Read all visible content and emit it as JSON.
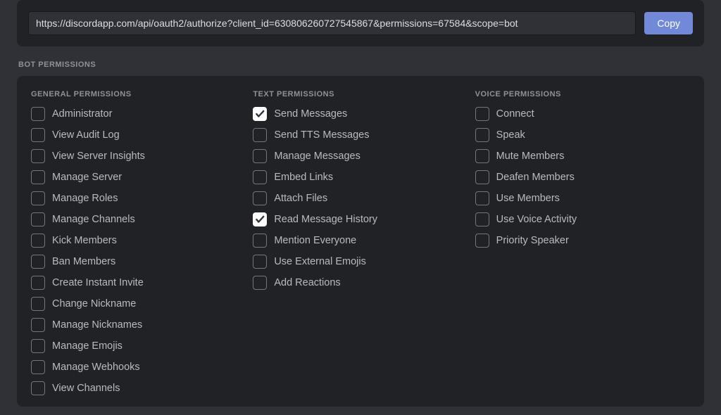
{
  "oauth": {
    "url": "https://discordapp.com/api/oauth2/authorize?client_id=630806260727545867&permissions=67584&scope=bot",
    "copy_label": "Copy"
  },
  "section_title": "Bot Permissions",
  "groups": [
    {
      "heading": "General Permissions",
      "items": [
        {
          "label": "Administrator",
          "checked": false
        },
        {
          "label": "View Audit Log",
          "checked": false
        },
        {
          "label": "View Server Insights",
          "checked": false
        },
        {
          "label": "Manage Server",
          "checked": false
        },
        {
          "label": "Manage Roles",
          "checked": false
        },
        {
          "label": "Manage Channels",
          "checked": false
        },
        {
          "label": "Kick Members",
          "checked": false
        },
        {
          "label": "Ban Members",
          "checked": false
        },
        {
          "label": "Create Instant Invite",
          "checked": false
        },
        {
          "label": "Change Nickname",
          "checked": false
        },
        {
          "label": "Manage Nicknames",
          "checked": false
        },
        {
          "label": "Manage Emojis",
          "checked": false
        },
        {
          "label": "Manage Webhooks",
          "checked": false
        },
        {
          "label": "View Channels",
          "checked": false
        }
      ]
    },
    {
      "heading": "Text Permissions",
      "items": [
        {
          "label": "Send Messages",
          "checked": true
        },
        {
          "label": "Send TTS Messages",
          "checked": false
        },
        {
          "label": "Manage Messages",
          "checked": false
        },
        {
          "label": "Embed Links",
          "checked": false
        },
        {
          "label": "Attach Files",
          "checked": false
        },
        {
          "label": "Read Message History",
          "checked": true
        },
        {
          "label": "Mention Everyone",
          "checked": false
        },
        {
          "label": "Use External Emojis",
          "checked": false
        },
        {
          "label": "Add Reactions",
          "checked": false
        }
      ]
    },
    {
      "heading": "Voice Permissions",
      "items": [
        {
          "label": "Connect",
          "checked": false
        },
        {
          "label": "Speak",
          "checked": false
        },
        {
          "label": "Mute Members",
          "checked": false
        },
        {
          "label": "Deafen Members",
          "checked": false
        },
        {
          "label": "Use Members",
          "checked": false
        },
        {
          "label": "Use Voice Activity",
          "checked": false
        },
        {
          "label": "Priority Speaker",
          "checked": false
        }
      ]
    }
  ]
}
